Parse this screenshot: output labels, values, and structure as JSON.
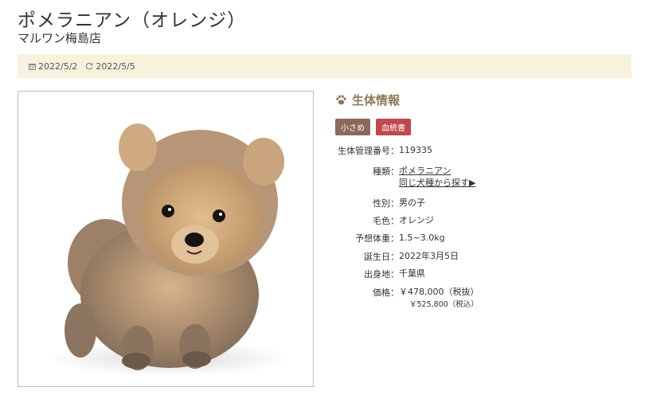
{
  "header": {
    "title": "ポメラニアン（オレンジ）",
    "shop": "マルワン梅島店"
  },
  "dates": {
    "posted": "2022/5/2",
    "updated": "2022/5/5",
    "posted_icon": "calendar-icon",
    "updated_icon": "refresh-icon"
  },
  "photo": {
    "subject": "pomeranian-puppy-photo"
  },
  "info": {
    "heading": "生体情報",
    "heading_icon": "paw-icon",
    "badges": [
      "小さめ",
      "血統書"
    ],
    "badge_colors": [
      "#8b6a5b",
      "#c0484e"
    ],
    "id_label": "生体管理番号：",
    "id_value": "119335",
    "breed_label": "種類：",
    "breed_value": "ポメラニアン",
    "breed_search": "同じ犬種から探す▶",
    "sex_label": "性別：",
    "sex_value": "男の子",
    "color_label": "毛色：",
    "color_value": "オレンジ",
    "weight_label": "予想体重：",
    "weight_value": "1.5~3.0kg",
    "birthday_label": "誕生日：",
    "birthday_value": "2022年3月5日",
    "origin_label": "出身地：",
    "origin_value": "千葉県",
    "price_label": "価格：",
    "price_value": "￥478,000（税抜）",
    "price_tax": "￥525,800（税込）"
  },
  "colors": {
    "accent": "#8c7b58",
    "datebar_bg": "#f7f2dd"
  }
}
